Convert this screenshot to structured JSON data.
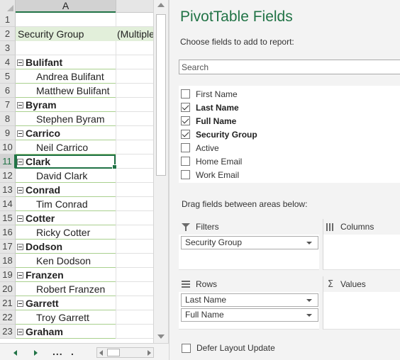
{
  "spreadsheet": {
    "column_header": "A",
    "active_row": "11",
    "filter_row": {
      "number": "2",
      "label": "Security Group",
      "value": "(Multiple"
    },
    "rows": [
      {
        "num": "1",
        "type": "blank",
        "text": ""
      },
      {
        "num": "2",
        "type": "filter",
        "text": ""
      },
      {
        "num": "3",
        "type": "blank",
        "text": ""
      },
      {
        "num": "4",
        "type": "group",
        "text": "Bulifant"
      },
      {
        "num": "5",
        "type": "name",
        "text": "Andrea Bulifant"
      },
      {
        "num": "6",
        "type": "name",
        "text": "Matthew Bulifant"
      },
      {
        "num": "7",
        "type": "group",
        "text": "Byram"
      },
      {
        "num": "8",
        "type": "name",
        "text": "Stephen Byram"
      },
      {
        "num": "9",
        "type": "group",
        "text": "Carrico"
      },
      {
        "num": "10",
        "type": "name",
        "text": "Neil Carrico"
      },
      {
        "num": "11",
        "type": "group",
        "text": "Clark"
      },
      {
        "num": "12",
        "type": "name",
        "text": "David Clark"
      },
      {
        "num": "13",
        "type": "group",
        "text": "Conrad"
      },
      {
        "num": "14",
        "type": "name",
        "text": "Tim Conrad"
      },
      {
        "num": "15",
        "type": "group",
        "text": "Cotter"
      },
      {
        "num": "16",
        "type": "name",
        "text": "Ricky Cotter"
      },
      {
        "num": "17",
        "type": "group",
        "text": "Dodson"
      },
      {
        "num": "18",
        "type": "name",
        "text": "Ken Dodson"
      },
      {
        "num": "19",
        "type": "group",
        "text": "Franzen"
      },
      {
        "num": "20",
        "type": "name",
        "text": "Robert Franzen"
      },
      {
        "num": "21",
        "type": "group",
        "text": "Garrett"
      },
      {
        "num": "22",
        "type": "name",
        "text": "Troy Garrett"
      },
      {
        "num": "23",
        "type": "group",
        "text": "Graham"
      }
    ],
    "sheet_nav": {
      "dots_1": "...",
      "dots_2": "."
    }
  },
  "pivot": {
    "title": "PivotTable Fields",
    "choose_label": "Choose fields to add to report:",
    "search_placeholder": "Search",
    "fields": [
      {
        "label": "First Name",
        "checked": false
      },
      {
        "label": "Last Name",
        "checked": true
      },
      {
        "label": "Full Name",
        "checked": true
      },
      {
        "label": "Security Group",
        "checked": true
      },
      {
        "label": "Active",
        "checked": false
      },
      {
        "label": "Home Email",
        "checked": false
      },
      {
        "label": "Work Email",
        "checked": false
      }
    ],
    "drag_label": "Drag fields between areas below:",
    "areas": {
      "filters": {
        "label": "Filters",
        "icon": "funnel-icon",
        "items": [
          "Security Group"
        ]
      },
      "columns": {
        "label": "Columns",
        "icon": "columns-icon",
        "items": []
      },
      "rows": {
        "label": "Rows",
        "icon": "rows-icon",
        "items": [
          "Last Name",
          "Full Name"
        ]
      },
      "values": {
        "label": "Values",
        "icon": "sigma-icon",
        "items": []
      }
    },
    "defer_label": "Defer Layout Update",
    "defer_checked": false
  },
  "colors": {
    "accent": "#217346",
    "filter_band": "#e2efda",
    "group_rule": "#a9d08e"
  }
}
